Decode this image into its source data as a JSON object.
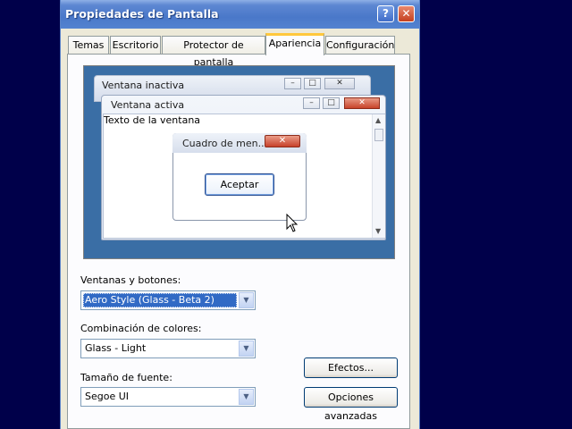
{
  "window": {
    "title": "Propiedades de Pantalla",
    "help_glyph": "?",
    "close_glyph": "✕"
  },
  "tabs": [
    {
      "label": "Temas"
    },
    {
      "label": "Escritorio"
    },
    {
      "label": "Protector de pantalla"
    },
    {
      "label": "Apariencia"
    },
    {
      "label": "Configuración"
    }
  ],
  "preview": {
    "inactive_title": "Ventana inactiva",
    "active_title": "Ventana activa",
    "window_text": "Texto de la ventana",
    "message_title": "Cuadro de men...",
    "ok_label": "Aceptar"
  },
  "form": {
    "windows_buttons_label": "Ventanas y botones:",
    "windows_buttons_value": "Aero Style (Glass - Beta 2)",
    "color_scheme_label": "Combinación de colores:",
    "color_scheme_value": "Glass - Light",
    "font_size_label": "Tamaño de fuente:",
    "font_size_value": "Segoe UI"
  },
  "buttons": {
    "effects_label": "Efectos...",
    "advanced_label": "Opciones avanzadas"
  },
  "colors": {
    "desktop": "#00004a",
    "preview_bg": "#3a6ea5",
    "selection": "#316ac5"
  }
}
